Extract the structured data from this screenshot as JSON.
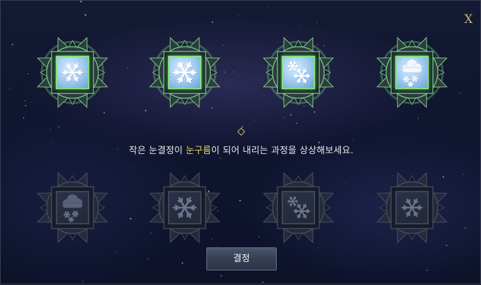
{
  "dialog": {
    "close_label": "X",
    "prompt_before": "작은 눈결정이 ",
    "prompt_highlight": "눈구름",
    "prompt_after": "이 되어 내리는 과정을 상상해보세요.",
    "confirm_label": "결정",
    "highlight_color": "#e8d86a"
  },
  "sequence_slots": [
    {
      "icon": "single-snowflake-icon",
      "state": "selected"
    },
    {
      "icon": "large-snowflake-icon",
      "state": "selected"
    },
    {
      "icon": "snowflake-cluster-icon",
      "state": "selected"
    },
    {
      "icon": "snow-cloud-icon",
      "state": "selected"
    }
  ],
  "choice_tiles": [
    {
      "icon": "snow-cloud-icon",
      "state": "used"
    },
    {
      "icon": "large-snowflake-icon",
      "state": "used"
    },
    {
      "icon": "snowflake-cluster-icon",
      "state": "used"
    },
    {
      "icon": "single-snowflake-icon",
      "state": "used"
    }
  ]
}
